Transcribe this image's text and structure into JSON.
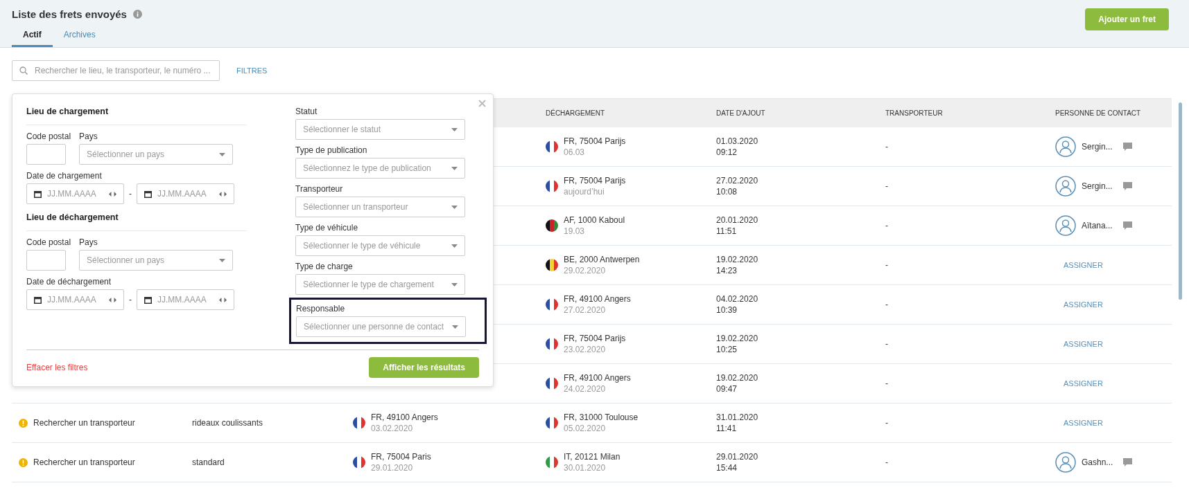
{
  "page": {
    "title": "Liste des frets envoyés",
    "add_button": "Ajouter un fret"
  },
  "tabs": [
    {
      "label": "Actif",
      "selected": true
    },
    {
      "label": "Archives",
      "selected": false
    }
  ],
  "search": {
    "placeholder": "Rechercher le lieu, le transporteur, le numéro ...",
    "filters_link": "FILTRES"
  },
  "filter_panel": {
    "sections": [
      {
        "title": "Lieu de chargement",
        "postal_label": "Code postal",
        "country_label": "Pays",
        "country_placeholder": "Sélectionner un pays",
        "date_label": "Date de chargement",
        "date_from_placeholder": "JJ.MM.AAAA",
        "date_separator": "-",
        "date_to_placeholder": "JJ.MM.AAAA"
      },
      {
        "title": "Lieu de déchargement",
        "postal_label": "Code postal",
        "country_label": "Pays",
        "country_placeholder": "Sélectionner un pays",
        "date_label": "Date de déchargement",
        "date_from_placeholder": "JJ.MM.AAAA",
        "date_separator": "-",
        "date_to_placeholder": "JJ.MM.AAAA"
      }
    ],
    "selects": [
      {
        "label": "Statut",
        "placeholder": "Sélectionner le statut",
        "highlighted": false
      },
      {
        "label": "Type de publication",
        "placeholder": "Sélectionnez le type de publication",
        "highlighted": false
      },
      {
        "label": "Transporteur",
        "placeholder": "Sélectionner un transporteur",
        "highlighted": false
      },
      {
        "label": "Type de véhicule",
        "placeholder": "Sélectionner le type de véhicule",
        "highlighted": false
      },
      {
        "label": "Type de charge",
        "placeholder": "Sélectionner le type de chargement",
        "highlighted": false
      },
      {
        "label": "Responsable",
        "placeholder": "Sélectionner une personne de contact",
        "highlighted": true
      }
    ],
    "clear_link": "Effacer les filtres",
    "apply_button": "Afficher les résultats"
  },
  "table": {
    "columns": [
      "DÉCHARGEMENT",
      "DATE D'AJOUT",
      "TRANSPORTEUR",
      "PERSONNE DE CONTACT"
    ],
    "rows": [
      {
        "unloading": {
          "kind": "fr",
          "place": "FR, 75004 Parijs",
          "date": "06.03"
        },
        "added_date": "01.03.2020",
        "added_time": "09:12",
        "carrier": "-",
        "contact": {
          "kind": "person",
          "text": "Sergin..."
        }
      },
      {
        "unloading": {
          "kind": "fr",
          "place": "FR, 75004 Parijs",
          "date": "aujourd’hui"
        },
        "added_date": "27.02.2020",
        "added_time": "10:08",
        "carrier": "-",
        "contact": {
          "kind": "person",
          "text": "Sergin..."
        }
      },
      {
        "unloading": {
          "kind": "af",
          "place": "AF, 1000 Kaboul",
          "date": "19.03"
        },
        "added_date": "20.01.2020",
        "added_time": "11:51",
        "carrier": "-",
        "contact": {
          "kind": "person",
          "text": "Aïtana..."
        }
      },
      {
        "unloading": {
          "kind": "be",
          "place": "BE, 2000 Antwerpen",
          "date": "29.02.2020"
        },
        "added_date": "19.02.2020",
        "added_time": "14:23",
        "carrier": "-",
        "contact": {
          "kind": "assign",
          "text": "ASSIGNER"
        }
      },
      {
        "unloading": {
          "kind": "fr",
          "place": "FR, 49100 Angers",
          "date": "27.02.2020"
        },
        "added_date": "04.02.2020",
        "added_time": "10:39",
        "carrier": "-",
        "contact": {
          "kind": "assign",
          "text": "ASSIGNER"
        }
      },
      {
        "unloading": {
          "kind": "fr",
          "place": "FR, 75004 Parijs",
          "date": "23.02.2020"
        },
        "added_date": "19.02.2020",
        "added_time": "10:25",
        "carrier": "-",
        "contact": {
          "kind": "assign",
          "text": "ASSIGNER"
        }
      },
      {
        "unloading": {
          "kind": "fr",
          "place": "FR, 49100 Angers",
          "date": "24.02.2020"
        },
        "added_date": "19.02.2020",
        "added_time": "09:47",
        "carrier": "-",
        "contact": {
          "kind": "assign",
          "text": "ASSIGNER"
        }
      },
      {
        "status": {
          "kind": "warning",
          "text": "Rechercher un transporteur"
        },
        "vehicle": "rideaux coulissants",
        "loading": {
          "kind": "fr",
          "place": "FR, 49100 Angers",
          "date": "03.02.2020"
        },
        "unloading": {
          "kind": "fr",
          "place": "FR, 31000 Toulouse",
          "date": "05.02.2020"
        },
        "added_date": "31.01.2020",
        "added_time": "11:41",
        "carrier": "-",
        "contact": {
          "kind": "assign",
          "text": "ASSIGNER"
        }
      },
      {
        "status": {
          "kind": "warning",
          "text": "Rechercher un transporteur"
        },
        "vehicle": "standard",
        "loading": {
          "kind": "fr",
          "place": "FR, 75004 Paris",
          "date": "29.01.2020"
        },
        "unloading": {
          "kind": "it",
          "place": "IT, 20121 Milan",
          "date": "30.01.2020"
        },
        "added_date": "29.01.2020",
        "added_time": "15:44",
        "carrier": "-",
        "contact": {
          "kind": "person",
          "text": "Gashn..."
        }
      }
    ]
  }
}
